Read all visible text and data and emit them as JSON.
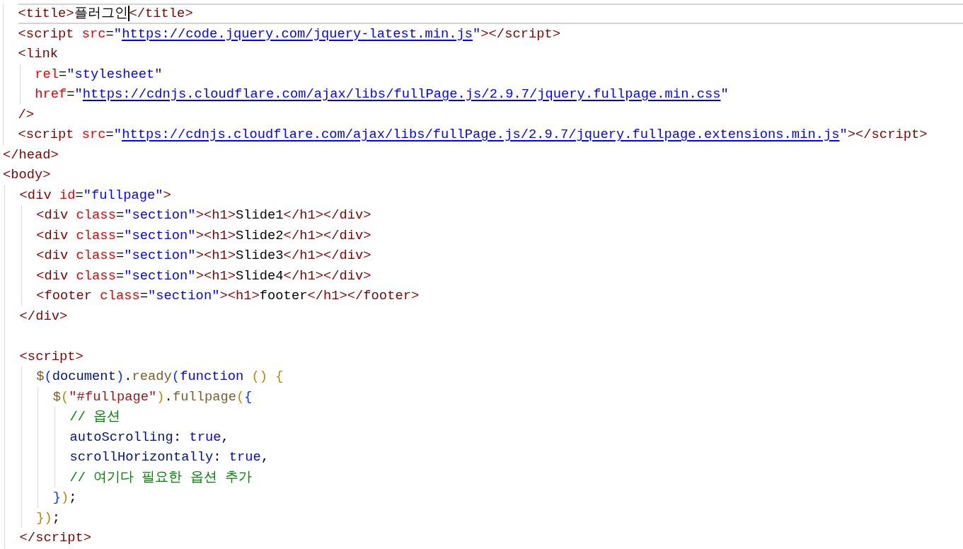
{
  "lines": [
    {
      "kind": "block",
      "children": [
        {
          "kind": "code",
          "current": true,
          "tokens": [
            {
              "kind": "tag",
              "text": "<title>"
            },
            {
              "kind": "text",
              "text": "플러그인",
              "cursor": true
            },
            {
              "kind": "tag",
              "text": "</title>"
            }
          ]
        },
        {
          "kind": "code",
          "current": false,
          "tokens": [
            {
              "kind": "tag",
              "text": "<script "
            },
            {
              "kind": "attr",
              "text": "src"
            },
            {
              "kind": "text",
              "text": "="
            },
            {
              "kind": "string",
              "text": "\""
            },
            {
              "kind": "url",
              "text": "https://code.jquery.com/jquery-latest.min.js"
            },
            {
              "kind": "string",
              "text": "\""
            },
            {
              "kind": "tag",
              "text": "></script>"
            }
          ]
        },
        {
          "kind": "code",
          "current": false,
          "tokens": [
            {
              "kind": "tag",
              "text": "<link"
            }
          ],
          "children": [
            {
              "kind": "code",
              "current": false,
              "tokens": [
                {
                  "kind": "attr",
                  "text": "rel"
                },
                {
                  "kind": "text",
                  "text": "="
                },
                {
                  "kind": "string",
                  "text": "\"stylesheet\""
                }
              ]
            },
            {
              "kind": "code",
              "current": false,
              "tokens": [
                {
                  "kind": "attr",
                  "text": "href"
                },
                {
                  "kind": "text",
                  "text": "="
                },
                {
                  "kind": "string",
                  "text": "\""
                },
                {
                  "kind": "url",
                  "text": "https://cdnjs.cloudflare.com/ajax/libs/fullPage.js/2.9.7/jquery.fullpage.min.css"
                },
                {
                  "kind": "string",
                  "text": "\""
                }
              ]
            }
          ]
        },
        {
          "kind": "code",
          "current": false,
          "tokens": [
            {
              "kind": "tag",
              "text": "/>"
            }
          ]
        },
        {
          "kind": "code",
          "current": false,
          "tokens": [
            {
              "kind": "tag",
              "text": "<script "
            },
            {
              "kind": "attr",
              "text": "src"
            },
            {
              "kind": "text",
              "text": "="
            },
            {
              "kind": "string",
              "text": "\""
            },
            {
              "kind": "url",
              "text": "https://cdnjs.cloudflare.com/ajax/libs/fullPage.js/2.9.7/jquery.fullpage.extensions.min.js"
            },
            {
              "kind": "string",
              "text": "\""
            },
            {
              "kind": "tag",
              "text": "></script>"
            }
          ]
        }
      ]
    },
    {
      "kind": "code",
      "current": false,
      "tokens": [
        {
          "kind": "tag",
          "text": "</head>"
        }
      ]
    },
    {
      "kind": "code",
      "current": false,
      "tokens": [
        {
          "kind": "tag",
          "text": "<body>"
        }
      ],
      "children": [
        {
          "kind": "code",
          "current": false,
          "tokens": [
            {
              "kind": "tag",
              "text": "<div "
            },
            {
              "kind": "attr",
              "text": "id"
            },
            {
              "kind": "text",
              "text": "="
            },
            {
              "kind": "string",
              "text": "\"fullpage\""
            },
            {
              "kind": "tag",
              "text": ">"
            }
          ],
          "children": [
            {
              "kind": "code",
              "current": false,
              "tokens": [
                {
                  "kind": "tag",
                  "text": "<div "
                },
                {
                  "kind": "attr",
                  "text": "class"
                },
                {
                  "kind": "text",
                  "text": "="
                },
                {
                  "kind": "string",
                  "text": "\"section\""
                },
                {
                  "kind": "tag",
                  "text": "><h1>"
                },
                {
                  "kind": "text",
                  "text": "Slide1"
                },
                {
                  "kind": "tag",
                  "text": "</h1></div>"
                }
              ]
            },
            {
              "kind": "code",
              "current": false,
              "tokens": [
                {
                  "kind": "tag",
                  "text": "<div "
                },
                {
                  "kind": "attr",
                  "text": "class"
                },
                {
                  "kind": "text",
                  "text": "="
                },
                {
                  "kind": "string",
                  "text": "\"section\""
                },
                {
                  "kind": "tag",
                  "text": "><h1>"
                },
                {
                  "kind": "text",
                  "text": "Slide2"
                },
                {
                  "kind": "tag",
                  "text": "</h1></div>"
                }
              ]
            },
            {
              "kind": "code",
              "current": false,
              "tokens": [
                {
                  "kind": "tag",
                  "text": "<div "
                },
                {
                  "kind": "attr",
                  "text": "class"
                },
                {
                  "kind": "text",
                  "text": "="
                },
                {
                  "kind": "string",
                  "text": "\"section\""
                },
                {
                  "kind": "tag",
                  "text": "><h1>"
                },
                {
                  "kind": "text",
                  "text": "Slide3"
                },
                {
                  "kind": "tag",
                  "text": "</h1></div>"
                }
              ]
            },
            {
              "kind": "code",
              "current": false,
              "tokens": [
                {
                  "kind": "tag",
                  "text": "<div "
                },
                {
                  "kind": "attr",
                  "text": "class"
                },
                {
                  "kind": "text",
                  "text": "="
                },
                {
                  "kind": "string",
                  "text": "\"section\""
                },
                {
                  "kind": "tag",
                  "text": "><h1>"
                },
                {
                  "kind": "text",
                  "text": "Slide4"
                },
                {
                  "kind": "tag",
                  "text": "</h1></div>"
                }
              ]
            },
            {
              "kind": "code",
              "current": false,
              "tokens": [
                {
                  "kind": "tag",
                  "text": "<footer "
                },
                {
                  "kind": "attr",
                  "text": "class"
                },
                {
                  "kind": "text",
                  "text": "="
                },
                {
                  "kind": "string",
                  "text": "\"section\""
                },
                {
                  "kind": "tag",
                  "text": "><h1>"
                },
                {
                  "kind": "text",
                  "text": "footer"
                },
                {
                  "kind": "tag",
                  "text": "</h1></footer>"
                }
              ]
            }
          ]
        },
        {
          "kind": "code",
          "current": false,
          "tokens": [
            {
              "kind": "tag",
              "text": "</div>"
            }
          ]
        },
        {
          "kind": "blank"
        },
        {
          "kind": "code",
          "current": false,
          "tokens": [
            {
              "kind": "tag",
              "text": "<script>"
            }
          ],
          "children": [
            {
              "kind": "code",
              "current": false,
              "tokens": [
                {
                  "kind": "fn",
                  "text": "$"
                },
                {
                  "kind": "bracket2",
                  "text": "("
                },
                {
                  "kind": "ident",
                  "text": "document"
                },
                {
                  "kind": "bracket2",
                  "text": ")"
                },
                {
                  "kind": "text",
                  "text": "."
                },
                {
                  "kind": "fn",
                  "text": "ready"
                },
                {
                  "kind": "bracket2",
                  "text": "("
                },
                {
                  "kind": "keyword",
                  "text": "function "
                },
                {
                  "kind": "bracket1",
                  "text": "() {"
                }
              ],
              "children": [
                {
                  "kind": "code",
                  "current": false,
                  "tokens": [
                    {
                      "kind": "fn",
                      "text": "$"
                    },
                    {
                      "kind": "bracket1",
                      "text": "("
                    },
                    {
                      "kind": "string2",
                      "text": "\"#fullpage\""
                    },
                    {
                      "kind": "bracket1",
                      "text": ")"
                    },
                    {
                      "kind": "text",
                      "text": "."
                    },
                    {
                      "kind": "fn",
                      "text": "fullpage"
                    },
                    {
                      "kind": "bracket1",
                      "text": "("
                    },
                    {
                      "kind": "bracket2",
                      "text": "{"
                    }
                  ],
                  "children": [
                    {
                      "kind": "code",
                      "current": false,
                      "tokens": [
                        {
                          "kind": "comment",
                          "text": "// 옵션"
                        }
                      ]
                    },
                    {
                      "kind": "code",
                      "current": false,
                      "tokens": [
                        {
                          "kind": "ident",
                          "text": "autoScrolling"
                        },
                        {
                          "kind": "text",
                          "text": ": "
                        },
                        {
                          "kind": "keyword",
                          "text": "true"
                        },
                        {
                          "kind": "text",
                          "text": ","
                        }
                      ]
                    },
                    {
                      "kind": "code",
                      "current": false,
                      "tokens": [
                        {
                          "kind": "ident",
                          "text": "scrollHorizontally"
                        },
                        {
                          "kind": "text",
                          "text": ": "
                        },
                        {
                          "kind": "keyword",
                          "text": "true"
                        },
                        {
                          "kind": "text",
                          "text": ","
                        }
                      ]
                    },
                    {
                      "kind": "code",
                      "current": false,
                      "tokens": [
                        {
                          "kind": "comment",
                          "text": "// 여기다 필요한 옵션 추가"
                        }
                      ]
                    }
                  ]
                },
                {
                  "kind": "code",
                  "current": false,
                  "tokens": [
                    {
                      "kind": "bracket2",
                      "text": "}"
                    },
                    {
                      "kind": "bracket1",
                      "text": ")"
                    },
                    {
                      "kind": "text",
                      "text": ";"
                    }
                  ]
                }
              ]
            },
            {
              "kind": "code",
              "current": false,
              "tokens": [
                {
                  "kind": "bracket1",
                  "text": "})"
                },
                {
                  "kind": "text",
                  "text": ";"
                }
              ]
            }
          ]
        },
        {
          "kind": "code",
          "current": false,
          "tokens": [
            {
              "kind": "tag",
              "text": "</script>"
            }
          ]
        }
      ]
    }
  ]
}
